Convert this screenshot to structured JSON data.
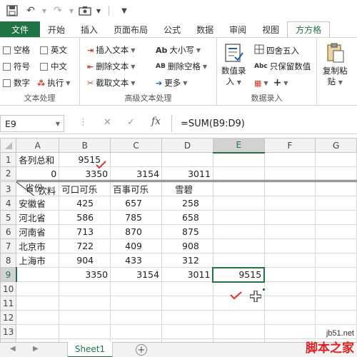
{
  "qat": {
    "icons": [
      "save-icon",
      "undo-icon",
      "redo-icon",
      "screenshot-icon",
      "customize-icon"
    ]
  },
  "tabs": [
    "文件",
    "开始",
    "插入",
    "页面布局",
    "公式",
    "数据",
    "审阅",
    "视图",
    "方方格"
  ],
  "ribbon": {
    "text_group": {
      "label": "文本处理",
      "checkboxes": [
        "空格",
        "英文",
        "符号",
        "中文",
        "数字"
      ],
      "execute": "执行"
    },
    "advanced_group": {
      "label": "高级文本处理",
      "insert_text": "插入文本",
      "delete_text": "删除文本",
      "extract_text": "截取文本",
      "case": "大小写",
      "delete_space": "删除空格",
      "more": "更多",
      "case_icon": "Ab",
      "delete_space_icon": "AB"
    },
    "data_group": {
      "label": "数据录入",
      "data_entry_line1": "数值录",
      "data_entry_line2": "入",
      "round": "四舍五入",
      "keep_value": "只保留数值",
      "keep_value_icon": "Abc",
      "plus": "+"
    },
    "paste_group": {
      "line1": "复制粘",
      "line2": "贴"
    }
  },
  "formula_bar": {
    "cell_ref": "E9",
    "formula": "=SUM(B9:D9)",
    "fx": "fx"
  },
  "grid": {
    "columns": [
      "A",
      "B",
      "C",
      "D",
      "E",
      "F",
      "G"
    ],
    "selected_column": "E",
    "selected_row": "9",
    "rows": [
      {
        "num": "1",
        "cells": [
          "各列总和",
          "9515",
          "",
          "",
          "",
          "",
          ""
        ]
      },
      {
        "num": "2",
        "cells": [
          "0",
          "3350",
          "3154",
          "3011",
          "",
          "",
          ""
        ]
      },
      {
        "num": "3",
        "cells": [
          "",
          "可口可乐",
          "百事可乐",
          "雪碧",
          "",
          "",
          ""
        ],
        "diag_top": "饮料",
        "diag_bottom": "省份"
      },
      {
        "num": "4",
        "cells": [
          "安徽省",
          "425",
          "657",
          "258",
          "",
          "",
          ""
        ]
      },
      {
        "num": "5",
        "cells": [
          "河北省",
          "586",
          "785",
          "658",
          "",
          "",
          ""
        ]
      },
      {
        "num": "6",
        "cells": [
          "河南省",
          "713",
          "870",
          "875",
          "",
          "",
          ""
        ]
      },
      {
        "num": "7",
        "cells": [
          "北京市",
          "722",
          "409",
          "908",
          "",
          "",
          ""
        ]
      },
      {
        "num": "8",
        "cells": [
          "上海市",
          "904",
          "433",
          "312",
          "",
          "",
          ""
        ]
      },
      {
        "num": "9",
        "cells": [
          "",
          "3350",
          "3154",
          "3011",
          "9515",
          "",
          ""
        ]
      },
      {
        "num": "10",
        "cells": [
          "",
          "",
          "",
          "",
          "",
          "",
          ""
        ]
      },
      {
        "num": "11",
        "cells": [
          "",
          "",
          "",
          "",
          "",
          "",
          ""
        ]
      },
      {
        "num": "12",
        "cells": [
          "",
          "",
          "",
          "",
          "",
          "",
          ""
        ]
      },
      {
        "num": "13",
        "cells": [
          "",
          "",
          "",
          "",
          "",
          "",
          ""
        ]
      },
      {
        "num": "14",
        "cells": [
          "",
          "",
          "",
          "",
          "",
          "",
          ""
        ]
      }
    ]
  },
  "sheet_tabs": {
    "active": "Sheet1",
    "add": "+"
  },
  "watermark": {
    "url": "jb51.net",
    "name": "脚本之家"
  }
}
